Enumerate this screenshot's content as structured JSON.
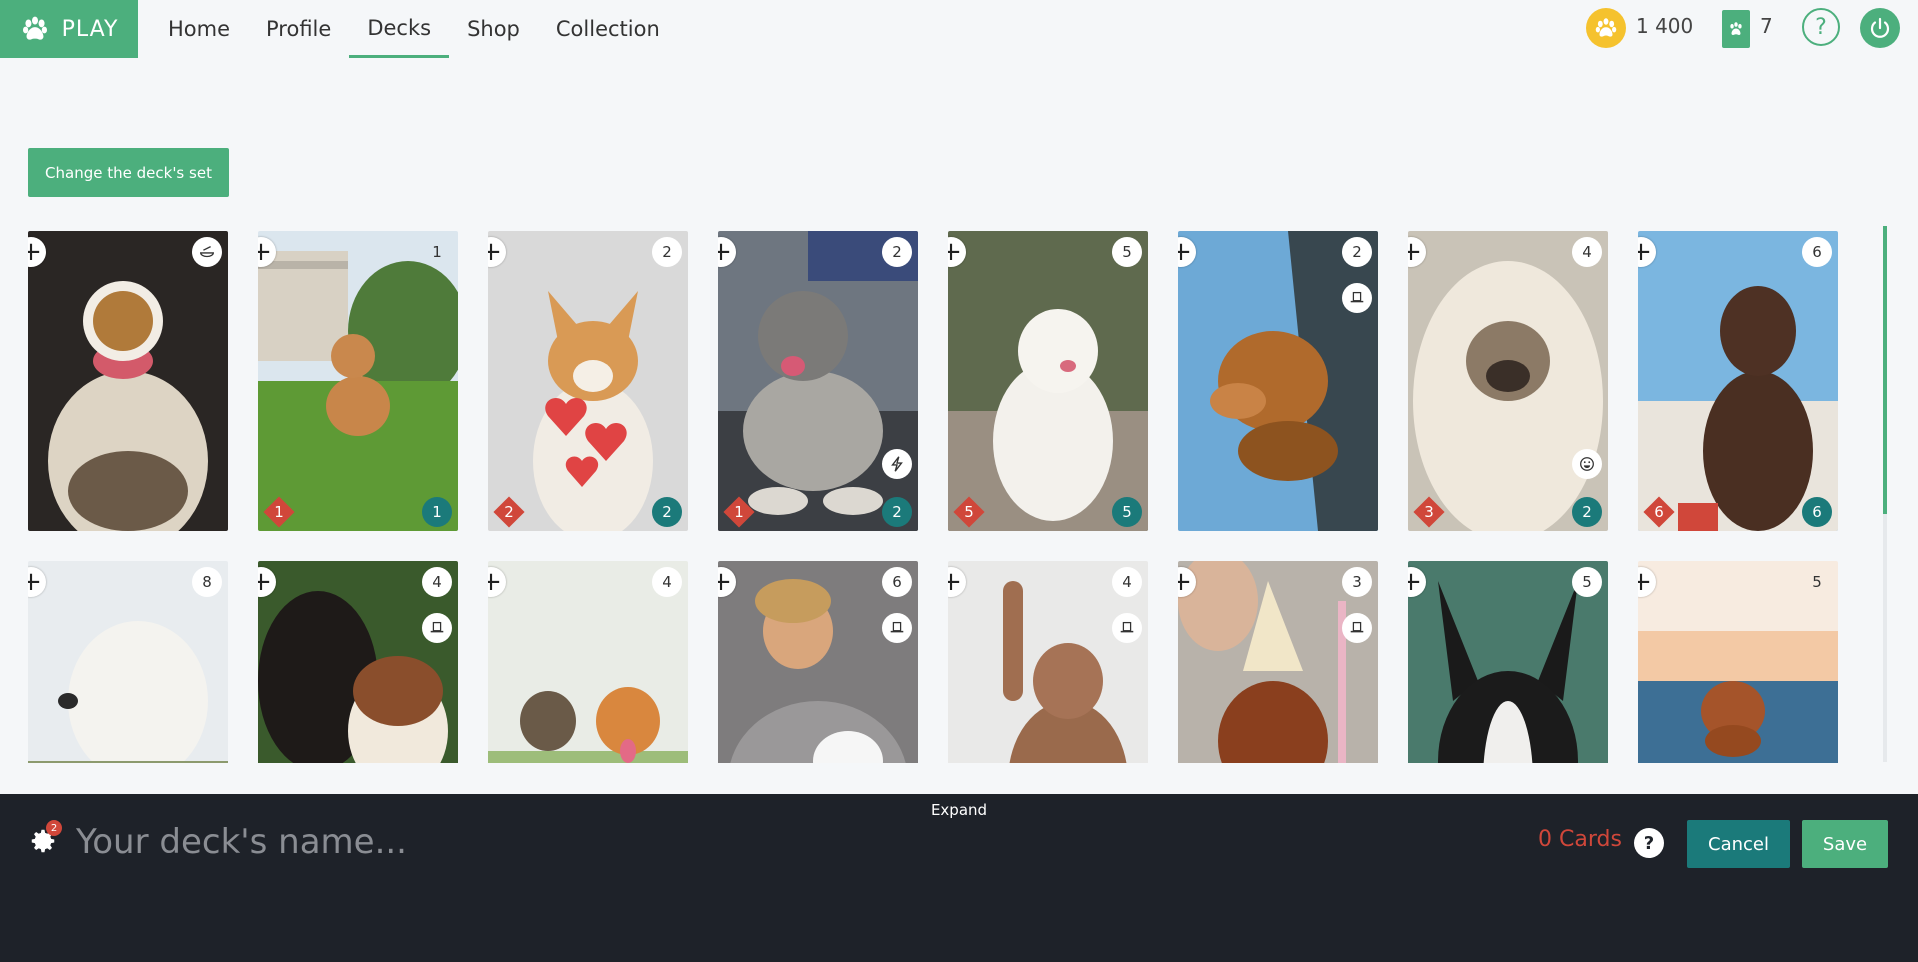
{
  "nav": {
    "play_label": "PLAY",
    "items": [
      {
        "label": "Home"
      },
      {
        "label": "Profile"
      },
      {
        "label": "Decks"
      },
      {
        "label": "Shop"
      },
      {
        "label": "Collection"
      }
    ],
    "active": "Decks"
  },
  "currency": {
    "coins": "1 400",
    "paws": "7",
    "coin_icon": "paw-coin-icon",
    "paw_icon": "paw-badge-icon"
  },
  "help_label": "?",
  "change_set_label": "Change the deck's set",
  "colors": {
    "accent": "#4caf7d",
    "teal": "#1b7a7a",
    "red": "#d0473a",
    "bar": "#1e2229"
  },
  "cards": [
    {
      "cost": "",
      "cost_icon": "food-bowl-icon",
      "attack": "",
      "health": "",
      "ability": ""
    },
    {
      "cost": "1",
      "attack": "1",
      "health": "1",
      "ability": ""
    },
    {
      "cost": "2",
      "attack": "2",
      "health": "2",
      "ability": ""
    },
    {
      "cost": "2",
      "attack": "1",
      "health": "2",
      "ability": "lightning-icon"
    },
    {
      "cost": "5",
      "attack": "5",
      "health": "5",
      "ability": ""
    },
    {
      "cost": "2",
      "attack": "",
      "health": "",
      "ability": "hat-icon"
    },
    {
      "cost": "4",
      "attack": "3",
      "health": "2",
      "ability": "smiley-icon"
    },
    {
      "cost": "6",
      "attack": "6",
      "health": "6",
      "ability": ""
    },
    {
      "cost": "8",
      "attack": "",
      "health": "",
      "ability": ""
    },
    {
      "cost": "4",
      "attack": "",
      "health": "",
      "ability": "hat-icon"
    },
    {
      "cost": "4",
      "attack": "",
      "health": "",
      "ability": ""
    },
    {
      "cost": "6",
      "attack": "",
      "health": "",
      "ability": "hat-icon"
    },
    {
      "cost": "4",
      "attack": "",
      "health": "",
      "ability": "hat-icon"
    },
    {
      "cost": "3",
      "attack": "",
      "health": "",
      "ability": "hat-icon"
    },
    {
      "cost": "5",
      "attack": "",
      "health": "",
      "ability": ""
    },
    {
      "cost": "5",
      "attack": "",
      "health": "",
      "ability": ""
    }
  ],
  "deck": {
    "expand_label": "Expand",
    "name_placeholder": "Your deck's name...",
    "settings_badge": "2",
    "card_count": "0 Cards",
    "help": "?",
    "cancel_label": "Cancel",
    "save_label": "Save"
  }
}
